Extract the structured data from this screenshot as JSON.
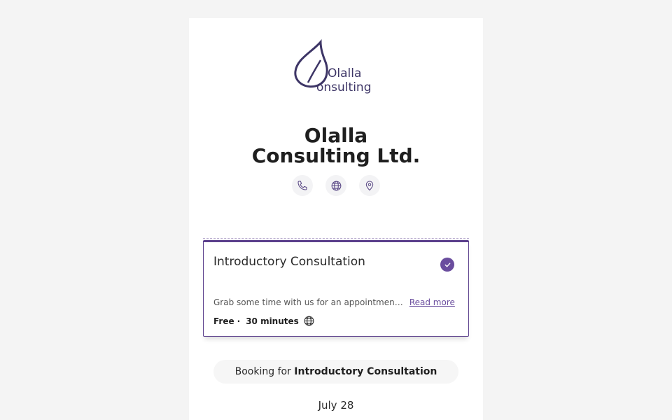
{
  "business": {
    "logo_text_line1": "Olalla",
    "logo_text_line2": "onsulting",
    "name_line1": "Olalla",
    "name_line2": "Consulting Ltd."
  },
  "contact": {
    "icons": [
      "phone-icon",
      "globe-icon",
      "location-pin-icon"
    ]
  },
  "service": {
    "title": "Introductory Consultation",
    "description": "Grab some time with us for an appointment to discuss your needs",
    "read_more": "Read more",
    "price": "Free",
    "separator": "·",
    "duration": "30 minutes",
    "selected": true
  },
  "booking": {
    "prefix": "Booking for",
    "service_name": "Introductory Consultation"
  },
  "calendar": {
    "date_label": "July 28"
  },
  "colors": {
    "accent": "#6a4d9e",
    "border": "#5b3f8c",
    "background": "#f4f4f4",
    "card": "#ffffff"
  }
}
